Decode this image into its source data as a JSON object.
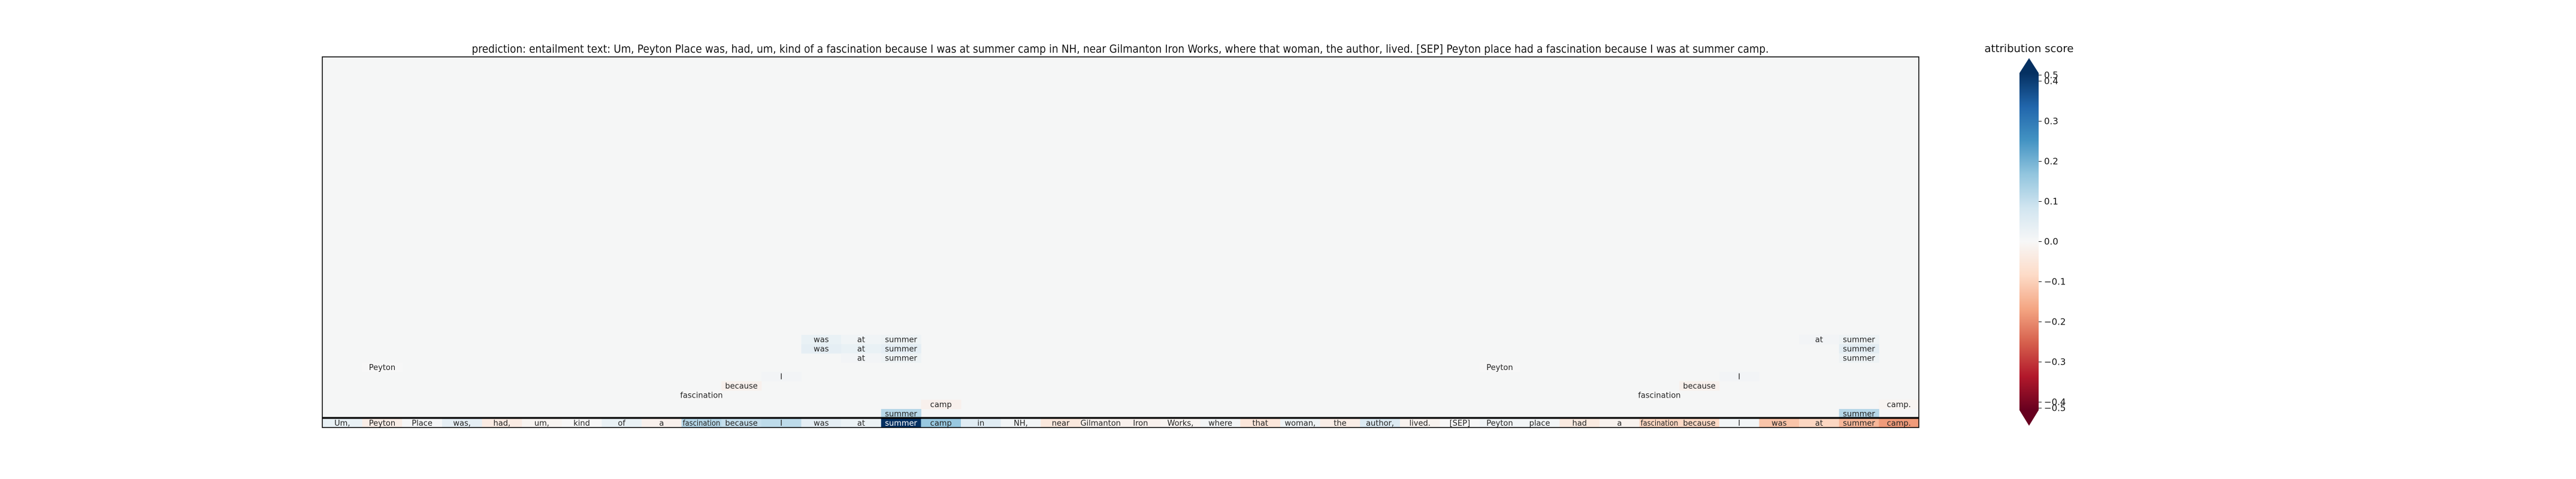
{
  "chart_data": {
    "type": "heatmap",
    "title": "prediction:  entailment     text:  Um, Peyton Place was, had, um, kind of a fascination because I was at summer camp in NH, near Gilmanton Iron Works, where that woman, the author, lived. [SEP] Peyton place had a fascination because I was at summer camp.",
    "colormap": "RdBu",
    "background_color": "#f5f6f6",
    "grid_rows": 40,
    "tokens": [
      "Um,",
      "Peyton",
      "Place",
      "was,",
      "had,",
      "um,",
      "kind",
      "of",
      "a",
      "fascination",
      "because",
      "I",
      "was",
      "at",
      "summer",
      "camp",
      "in",
      "NH,",
      "near",
      "Gilmanton",
      "Iron",
      "Works,",
      "where",
      "that",
      "woman,",
      "the",
      "author,",
      "lived.",
      "[SEP]",
      "Peyton",
      "place",
      "had",
      "a",
      "fascination",
      "because",
      "I",
      "was",
      "at",
      "summer",
      "camp."
    ],
    "token_scores": [
      0.03,
      -0.03,
      0.005,
      0.04,
      -0.035,
      -0.01,
      0.0,
      0.03,
      -0.02,
      0.12,
      0.1,
      0.11,
      0.04,
      0.025,
      0.42,
      0.16,
      0.05,
      0.01,
      -0.045,
      -0.015,
      -0.02,
      -0.01,
      0.01,
      -0.05,
      0.02,
      -0.03,
      0.06,
      -0.015,
      0.0,
      0.015,
      0.01,
      -0.04,
      -0.015,
      -0.09,
      -0.085,
      0.01,
      -0.12,
      -0.09,
      -0.14,
      -0.18
    ],
    "cells": [
      {
        "row": 31,
        "col": 13,
        "token": "was",
        "value": 0.03
      },
      {
        "row": 31,
        "col": 14,
        "token": "at",
        "value": 0.015
      },
      {
        "row": 31,
        "col": 15,
        "token": "summer",
        "value": 0.02
      },
      {
        "row": 31,
        "col": 38,
        "token": "at",
        "value": 0.012
      },
      {
        "row": 31,
        "col": 39,
        "token": "summer",
        "value": 0.02
      },
      {
        "row": 32,
        "col": 13,
        "token": "was",
        "value": 0.04
      },
      {
        "row": 32,
        "col": 14,
        "token": "at",
        "value": 0.03
      },
      {
        "row": 32,
        "col": 15,
        "token": "summer",
        "value": 0.04
      },
      {
        "row": 32,
        "col": 39,
        "token": "summer",
        "value": 0.045
      },
      {
        "row": 33,
        "col": 14,
        "token": "at",
        "value": 0.012
      },
      {
        "row": 33,
        "col": 15,
        "token": "summer",
        "value": 0.02
      },
      {
        "row": 33,
        "col": 39,
        "token": "summer",
        "value": 0.02
      },
      {
        "row": 34,
        "col": 2,
        "token": "Peyton",
        "value": 0.0
      },
      {
        "row": 34,
        "col": 30,
        "token": "Peyton",
        "value": 0.0
      },
      {
        "row": 35,
        "col": 12,
        "token": "I",
        "value": 0.012
      },
      {
        "row": 35,
        "col": 36,
        "token": "I",
        "value": 0.012
      },
      {
        "row": 36,
        "col": 11,
        "token": "because",
        "value": -0.02
      },
      {
        "row": 36,
        "col": 35,
        "token": "because",
        "value": -0.02
      },
      {
        "row": 37,
        "col": 10,
        "token": "fascination",
        "value": 0.0
      },
      {
        "row": 37,
        "col": 34,
        "token": "fascination",
        "value": 0.0
      },
      {
        "row": 38,
        "col": 16,
        "token": "camp",
        "value": -0.02
      },
      {
        "row": 38,
        "col": 40,
        "token": "camp.",
        "value": -0.01
      },
      {
        "row": 39,
        "col": 15,
        "token": "summer",
        "value": 0.12
      },
      {
        "row": 39,
        "col": 39,
        "token": "summer",
        "value": 0.12
      }
    ],
    "colorbar": {
      "label": "attribution score",
      "ticks": [
        {
          "label": "0.5",
          "value": 0.5
        },
        {
          "label": "0.4",
          "value": 0.4
        },
        {
          "label": "0.3",
          "value": 0.3
        },
        {
          "label": "0.2",
          "value": 0.2
        },
        {
          "label": "0.1",
          "value": 0.1
        },
        {
          "label": "0.0",
          "value": 0.0
        },
        {
          "label": "−0.1",
          "value": -0.1
        },
        {
          "label": "−0.2",
          "value": -0.2
        },
        {
          "label": "−0.3",
          "value": -0.3
        },
        {
          "label": "−0.4",
          "value": -0.4
        },
        {
          "label": "−0.5",
          "value": -0.5
        }
      ],
      "extend": "both"
    }
  }
}
